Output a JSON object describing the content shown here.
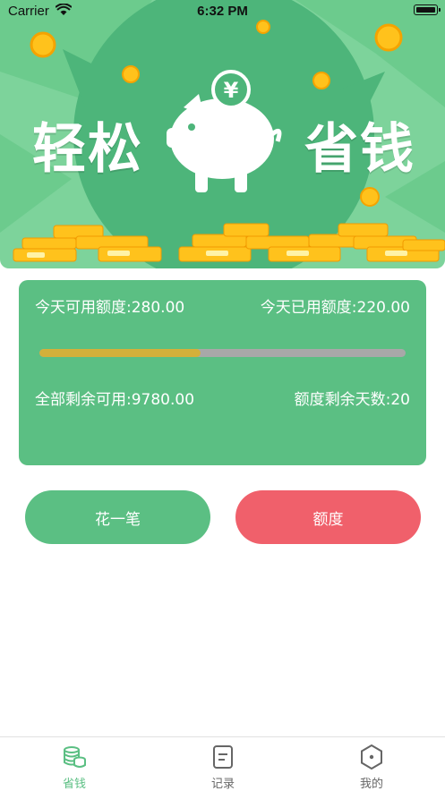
{
  "status_bar": {
    "carrier": "Carrier",
    "time": "6:32 PM"
  },
  "banner": {
    "left_text": "轻松",
    "right_text": "省钱",
    "coin_symbol": "¥"
  },
  "quota": {
    "today_available_label": "今天可用额度:280.00",
    "today_used_label": "今天已用额度:220.00",
    "total_remaining_label": "全部剩余可用:9780.00",
    "remaining_days_label": "额度剩余天数:20",
    "progress_fraction": 0.44
  },
  "actions": {
    "spend_label": "花一笔",
    "quota_label": "额度"
  },
  "tabs": [
    {
      "label": "省钱",
      "icon": "coins-stack-icon",
      "active": true
    },
    {
      "label": "记录",
      "icon": "document-icon",
      "active": false
    },
    {
      "label": "我的",
      "icon": "hexagon-icon",
      "active": false
    }
  ],
  "colors": {
    "primary": "#5bbf83",
    "accent_red": "#f0606b",
    "progress": "#d4b03a",
    "track": "#a8a8a8"
  }
}
